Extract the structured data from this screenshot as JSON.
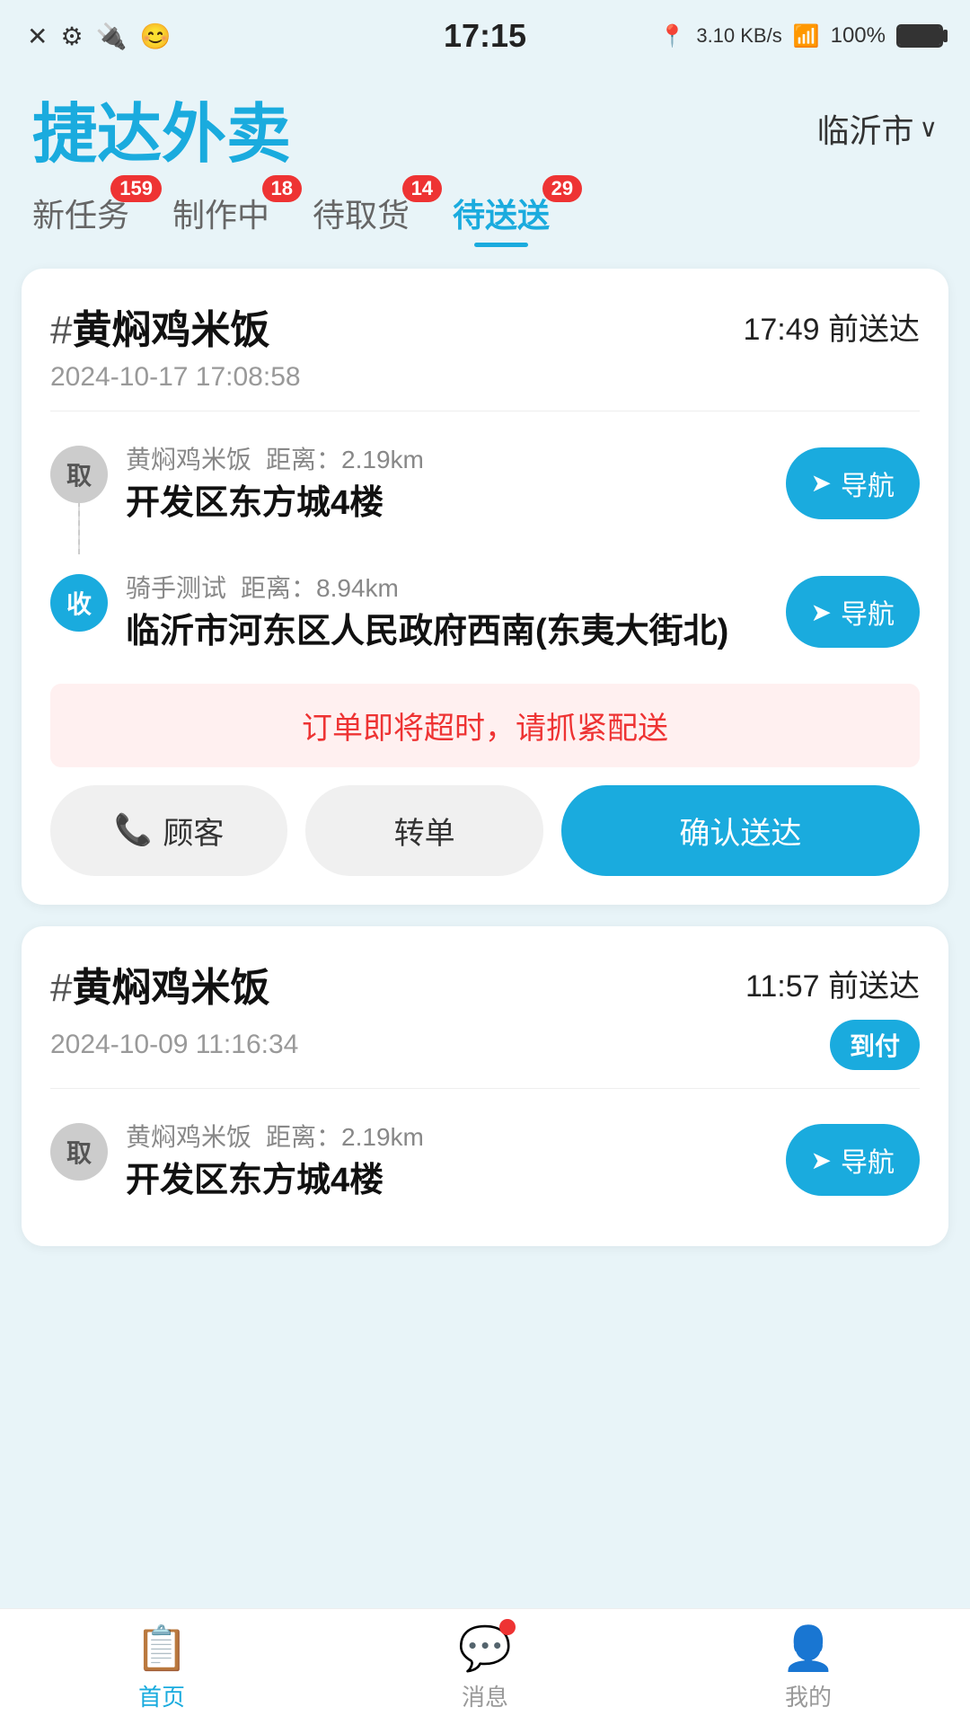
{
  "statusBar": {
    "time": "17:15",
    "dataSpeed": "3.10 KB/s",
    "signal": "WiFi",
    "battery": "100%"
  },
  "header": {
    "appTitle": "捷达外卖",
    "location": "临沂市",
    "locationArrow": "∨"
  },
  "tabs": [
    {
      "id": "new",
      "label": "新任务",
      "badge": "159",
      "active": false
    },
    {
      "id": "making",
      "label": "制作中",
      "badge": "18",
      "active": false
    },
    {
      "id": "pickup",
      "label": "待取货",
      "badge": "14",
      "active": false
    },
    {
      "id": "delivery",
      "label": "待送送",
      "badge": "29",
      "active": true
    }
  ],
  "cards": [
    {
      "id": "card1",
      "restaurant": "黄焖鸡米饭",
      "hash": "#",
      "deadline": "17:49 前送达",
      "orderTime": "2024-10-17 17:08:58",
      "pickup": {
        "label": "取",
        "name": "黄焖鸡米饭",
        "distance": "距离：2.19km",
        "address": "开发区东方城4楼",
        "navLabel": "导航"
      },
      "delivery": {
        "label": "收",
        "name": "骑手测试",
        "distance": "距离：8.94km",
        "address": "临沂市河东区人民政府西南(东夷大街北)",
        "navLabel": "导航"
      },
      "warning": "订单即将超时，请抓紧配送",
      "actions": {
        "call": "顾客",
        "transfer": "转单",
        "confirm": "确认送达"
      }
    },
    {
      "id": "card2",
      "restaurant": "黄焖鸡米饭",
      "hash": "#",
      "deadline": "11:57 前送达",
      "orderTime": "2024-10-09 11:16:34",
      "topay": "到付",
      "pickup": {
        "label": "取",
        "name": "黄焖鸡米饭",
        "distance": "距离：2.19km",
        "address": "开发区东方城4楼",
        "navLabel": "导航"
      }
    }
  ],
  "bottomNav": [
    {
      "id": "home",
      "icon": "📋",
      "label": "首页",
      "active": true
    },
    {
      "id": "messages",
      "icon": "💬",
      "label": "消息",
      "active": false,
      "hasBadge": true
    },
    {
      "id": "profile",
      "icon": "👤",
      "label": "我的",
      "active": false
    }
  ]
}
